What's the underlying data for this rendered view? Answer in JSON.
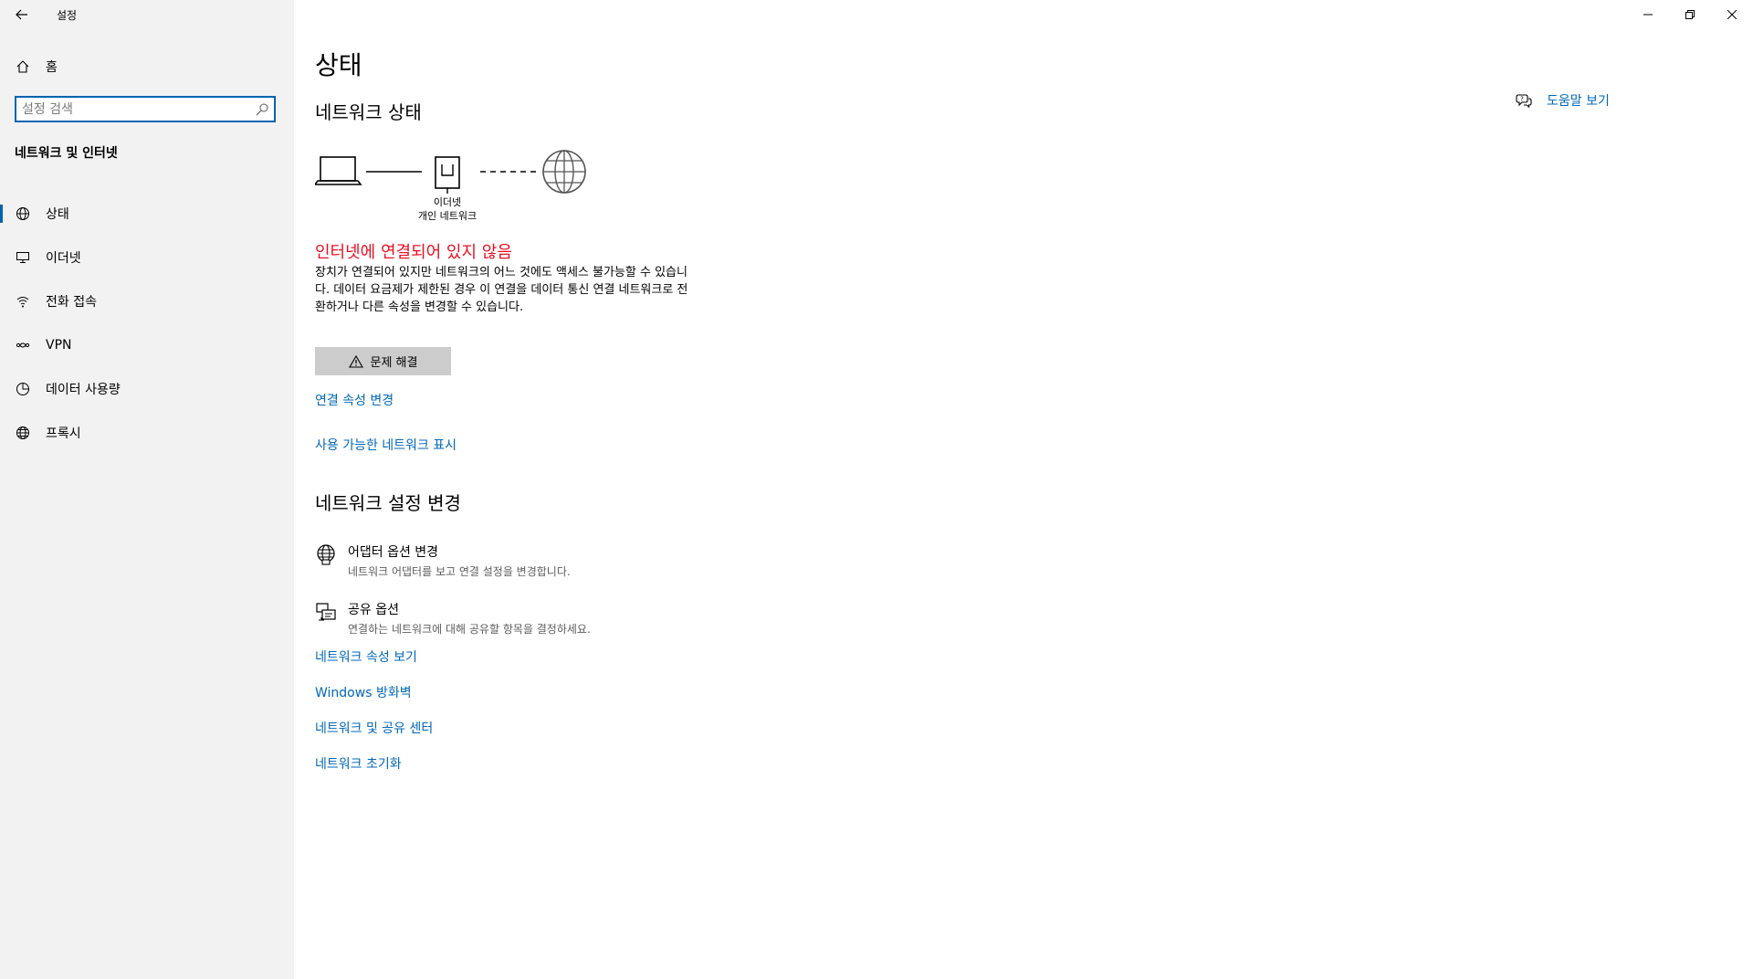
{
  "window": {
    "app_title": "설정",
    "controls": [
      "minimize-icon",
      "restore-icon",
      "close-icon"
    ]
  },
  "sidebar": {
    "home_label": "홈",
    "search_placeholder": "설정 검색",
    "section_title": "네트워크 및 인터넷",
    "items": [
      {
        "label": "상태",
        "icon": "status-globe-icon",
        "active": true
      },
      {
        "label": "이더넷",
        "icon": "ethernet-icon",
        "active": false
      },
      {
        "label": "전화 접속",
        "icon": "dial-up-icon",
        "active": false
      },
      {
        "label": "VPN",
        "icon": "vpn-icon",
        "active": false
      },
      {
        "label": "데이터 사용량",
        "icon": "data-usage-icon",
        "active": false
      },
      {
        "label": "프록시",
        "icon": "proxy-globe-icon",
        "active": false
      }
    ]
  },
  "main": {
    "page_title": "상태",
    "network_status_heading": "네트워크 상태",
    "help_link": "도움말 보기",
    "diagram": {
      "adapter_name": "이더넷",
      "network_profile": "개인 네트워크"
    },
    "status_headline": "인터넷에 연결되어 있지 않음",
    "status_description": "장치가 연결되어 있지만 네트워크의 어느 것에도 액세스 불가능할 수 있습니다. 데이터 요금제가 제한된 경우 이 연결을 데이터 통신 연결 네트워크로 전환하거나 다른 속성을 변경할 수 있습니다.",
    "troubleshoot_label": "문제 해결",
    "link_connection_properties": "연결 속성 변경",
    "link_show_networks": "사용 가능한 네트워크 표시",
    "change_settings_heading": "네트워크 설정 변경",
    "options": [
      {
        "title": "어댑터 옵션 변경",
        "subtitle": "네트워크 어댑터를 보고 연결 설정을 변경합니다.",
        "icon": "adapter-options-icon"
      },
      {
        "title": "공유 옵션",
        "subtitle": "연결하는 네트워크에 대해 공유할 항목을 결정하세요.",
        "icon": "sharing-options-icon"
      }
    ],
    "bottom_links": [
      "네트워크 속성 보기",
      "Windows 방화벽",
      "네트워크 및 공유 센터",
      "네트워크 초기화"
    ]
  },
  "colors": {
    "accent": "#0067b8",
    "error": "#e81123",
    "sidebar_bg": "#f2f2f2",
    "button_bg": "#cccccc"
  }
}
